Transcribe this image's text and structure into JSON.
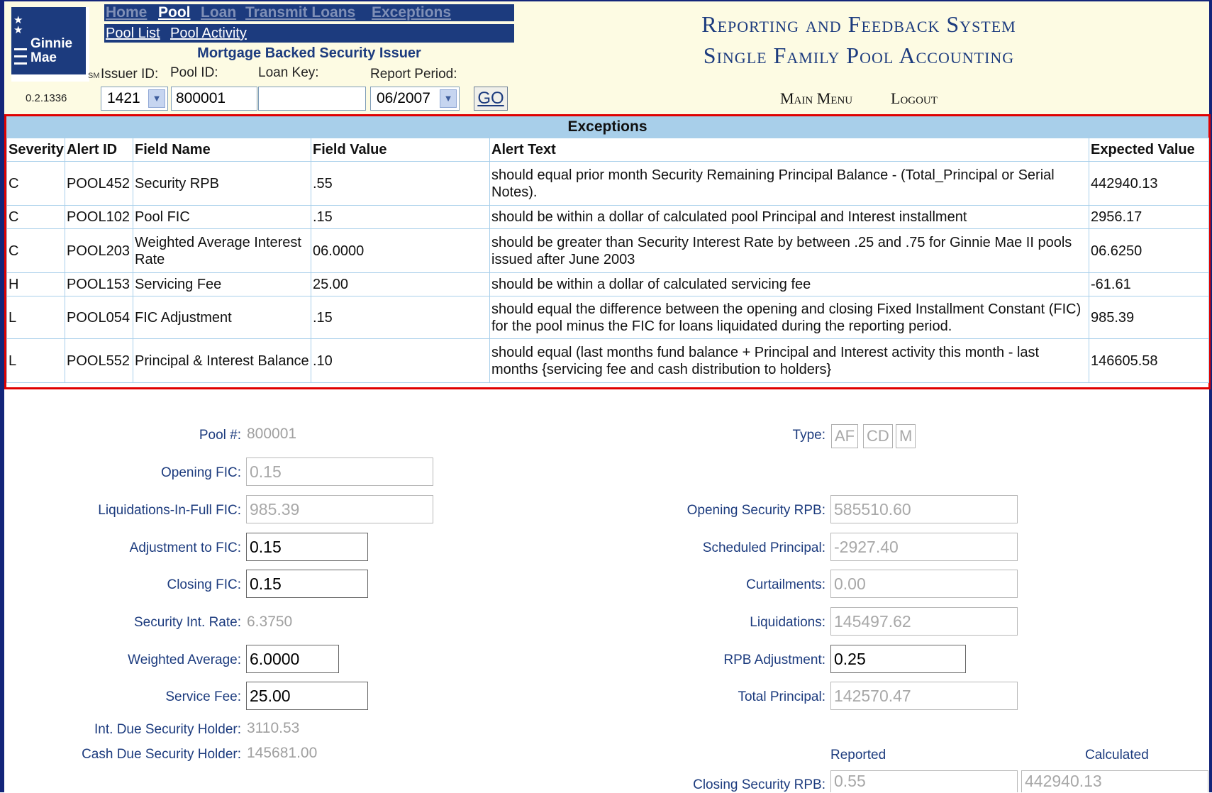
{
  "header": {
    "logo_text_1": "Ginnie",
    "logo_text_2": "Mae",
    "logo_sm": "SM",
    "version": "0.2.1336",
    "nav": [
      "Home",
      "Pool",
      "Loan",
      "Transmit Loans",
      "Exceptions"
    ],
    "subnav": [
      "Pool List",
      "Pool Activity"
    ],
    "issuer_title": "Mortgage Backed Security Issuer",
    "labels": {
      "issuer_id": "Issuer ID:",
      "pool_id": "Pool ID:",
      "loan_key": "Loan Key:",
      "report_period": "Report Period:"
    },
    "issuer_id_value": "1421",
    "pool_id_value": "800001",
    "loan_key_value": "",
    "report_period_value": "06/2007",
    "go_label": "GO",
    "system_title_1": "Reporting and Feedback System",
    "system_title_2": "Single Family Pool Accounting",
    "main_menu": "Main Menu",
    "logout": "Logout"
  },
  "exceptions": {
    "title": "Exceptions",
    "columns": [
      "Severity",
      "Alert ID",
      "Field Name",
      "Field Value",
      "Alert Text",
      "Expected Value"
    ],
    "rows": [
      [
        "C",
        "POOL452",
        "Security RPB",
        ".55",
        "should equal prior month Security Remaining Principal Balance - (Total_Principal or Serial Notes).",
        "442940.13"
      ],
      [
        "C",
        "POOL102",
        "Pool FIC",
        ".15",
        "should be within a dollar of calculated pool Principal and Interest installment",
        "2956.17"
      ],
      [
        "C",
        "POOL203",
        "Weighted Average Interest Rate",
        "06.0000",
        "should be greater than Security Interest Rate by between .25 and .75 for Ginnie Mae II pools issued after June 2003",
        "06.6250"
      ],
      [
        "H",
        "POOL153",
        "Servicing Fee",
        "25.00",
        "should be within a dollar of calculated servicing fee",
        "-61.61"
      ],
      [
        "L",
        "POOL054",
        "FIC Adjustment",
        ".15",
        "should equal the difference between the opening and closing Fixed Installment Constant (FIC) for the pool minus the FIC for loans liquidated during the reporting period.",
        "985.39"
      ],
      [
        "L",
        "POOL552",
        "Principal & Interest Balance",
        ".10",
        "should equal (last months fund balance + Principal and Interest activity this month - last months {servicing fee and cash distribution to holders}",
        "146605.58"
      ]
    ]
  },
  "detail": {
    "pool_num_label": "Pool #:",
    "pool_num_value": "800001",
    "type_label": "Type:",
    "type_options": [
      "AF",
      "CD",
      "M"
    ],
    "opening_fic_label": "Opening FIC:",
    "opening_fic_value": "0.15",
    "liq_fic_label": "Liquidations-In-Full FIC:",
    "liq_fic_value": "985.39",
    "adj_fic_label": "Adjustment to FIC:",
    "adj_fic_value": "0.15",
    "closing_fic_label": "Closing FIC:",
    "closing_fic_value": "0.15",
    "sec_int_rate_label": "Security Int. Rate:",
    "sec_int_rate_value": "6.3750",
    "weighted_avg_label": "Weighted Average:",
    "weighted_avg_value": "6.0000",
    "service_fee_label": "Service Fee:",
    "service_fee_value": "25.00",
    "int_due_label": "Int. Due Security Holder:",
    "int_due_value": "3110.53",
    "cash_due_label": "Cash Due Security Holder:",
    "cash_due_value": "145681.00",
    "opening_rpb_label": "Opening Security RPB:",
    "opening_rpb_value": "585510.60",
    "sched_principal_label": "Scheduled Principal:",
    "sched_principal_value": "-2927.40",
    "curtailments_label": "Curtailments:",
    "curtailments_value": "0.00",
    "liquidations_label": "Liquidations:",
    "liquidations_value": "145497.62",
    "rpb_adj_label": "RPB Adjustment:",
    "rpb_adj_value": "0.25",
    "total_principal_label": "Total Principal:",
    "total_principal_value": "142570.47",
    "reported_label": "Reported",
    "calculated_label": "Calculated",
    "closing_rpb_label": "Closing Security RPB:",
    "closing_rpb_reported": "0.55",
    "closing_rpb_calculated": "442940.13"
  },
  "colors": {
    "navy": "#1c3b7e",
    "frame": "#13257a",
    "table_header": "#a8cfea",
    "highlight_border": "#e00000",
    "header_bg": "#fdfbe3"
  }
}
